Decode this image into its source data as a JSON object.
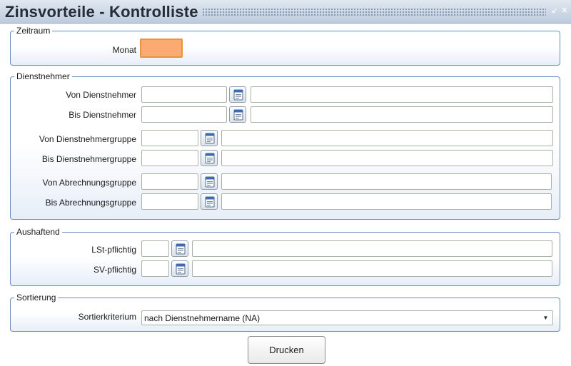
{
  "window": {
    "title": "Zinsvorteile - Kontrolliste"
  },
  "zeitraum": {
    "legend": "Zeitraum",
    "monat_label": "Monat",
    "monat_value": ""
  },
  "dienstnehmer": {
    "legend": "Dienstnehmer",
    "von_dn_label": "Von Dienstnehmer",
    "bis_dn_label": "Bis Dienstnehmer",
    "von_dng_label": "Von Dienstnehmergruppe",
    "bis_dng_label": "Bis Dienstnehmergruppe",
    "von_abr_label": "Von Abrechnungsgruppe",
    "bis_abr_label": "Bis Abrechnungsgruppe"
  },
  "aushaftend": {
    "legend": "Aushaftend",
    "lst_label": "LSt-pflichtig",
    "sv_label": "SV-pflichtig"
  },
  "sortierung": {
    "legend": "Sortierung",
    "kriterium_label": "Sortierkriterium",
    "kriterium_value": "nach Dienstnehmername (NA)"
  },
  "actions": {
    "print_label": "Drucken"
  },
  "icons": {
    "picker": "calendar-lookup-icon",
    "minimize": "minimize-icon",
    "close": "close-icon",
    "dropdown": "chevron-down-icon"
  },
  "colors": {
    "title_bar": "#bccbdc",
    "group_border": "#6f8db8",
    "focus_field": "#fbaa72",
    "focus_border": "#e59540"
  }
}
